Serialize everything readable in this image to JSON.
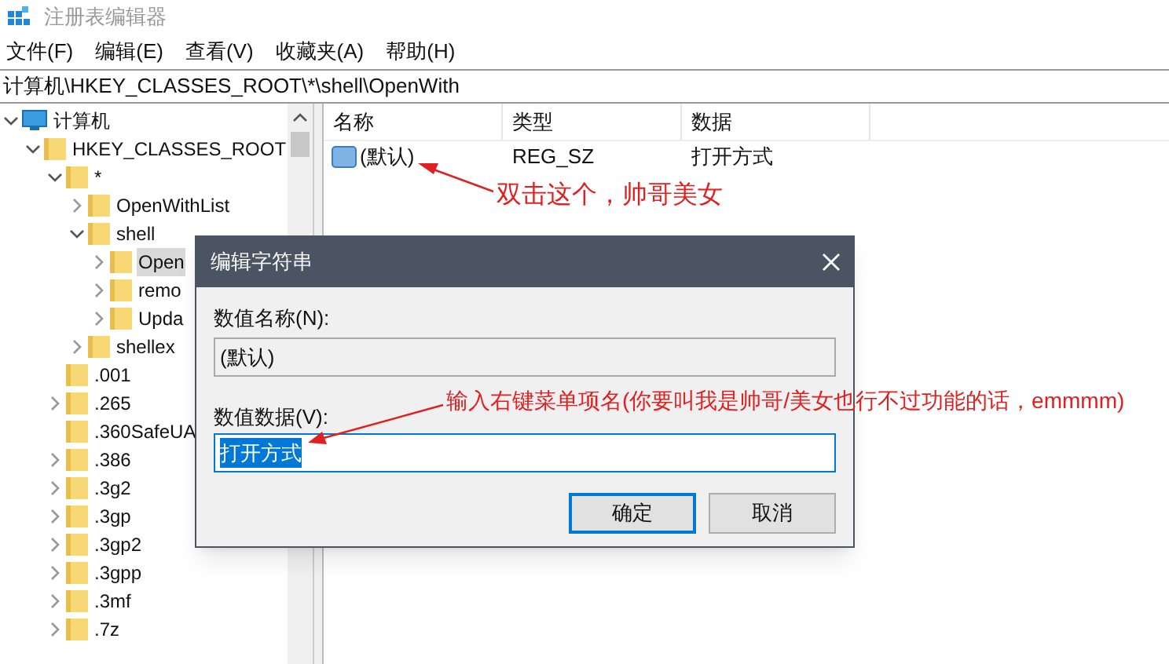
{
  "window": {
    "title": "注册表编辑器"
  },
  "menu": [
    "文件(F)",
    "编辑(E)",
    "查看(V)",
    "收藏夹(A)",
    "帮助(H)"
  ],
  "address": "计算机\\HKEY_CLASSES_ROOT\\*\\shell\\OpenWith",
  "tree": [
    {
      "label": "计算机",
      "kind": "computer",
      "expandable": true,
      "expanded": true,
      "selected": false,
      "children": [
        {
          "label": "HKEY_CLASSES_ROOT",
          "kind": "folder",
          "expandable": true,
          "expanded": true,
          "selected": false,
          "children": [
            {
              "label": "*",
              "kind": "folder",
              "expandable": true,
              "expanded": true,
              "selected": false,
              "children": [
                {
                  "label": "OpenWithList",
                  "kind": "folder",
                  "expandable": true,
                  "expanded": false,
                  "selected": false
                },
                {
                  "label": "shell",
                  "kind": "folder",
                  "expandable": true,
                  "expanded": true,
                  "selected": false,
                  "children": [
                    {
                      "label": "Open",
                      "kind": "folder",
                      "expandable": true,
                      "expanded": false,
                      "selected": true
                    },
                    {
                      "label": "remo",
                      "kind": "folder",
                      "expandable": true,
                      "expanded": false,
                      "selected": false
                    },
                    {
                      "label": "Upda",
                      "kind": "folder",
                      "expandable": true,
                      "expanded": false,
                      "selected": false
                    }
                  ]
                },
                {
                  "label": "shellex",
                  "kind": "folder",
                  "expandable": true,
                  "expanded": false,
                  "selected": false
                }
              ]
            },
            {
              "label": ".001",
              "kind": "folder",
              "expandable": false,
              "selected": false
            },
            {
              "label": ".265",
              "kind": "folder",
              "expandable": true,
              "expanded": false,
              "selected": false
            },
            {
              "label": ".360SafeUA",
              "kind": "folder",
              "expandable": false,
              "selected": false
            },
            {
              "label": ".386",
              "kind": "folder",
              "expandable": true,
              "expanded": false,
              "selected": false
            },
            {
              "label": ".3g2",
              "kind": "folder",
              "expandable": true,
              "expanded": false,
              "selected": false
            },
            {
              "label": ".3gp",
              "kind": "folder",
              "expandable": true,
              "expanded": false,
              "selected": false
            },
            {
              "label": ".3gp2",
              "kind": "folder",
              "expandable": true,
              "expanded": false,
              "selected": false
            },
            {
              "label": ".3gpp",
              "kind": "folder",
              "expandable": true,
              "expanded": false,
              "selected": false
            },
            {
              "label": ".3mf",
              "kind": "folder",
              "expandable": true,
              "expanded": false,
              "selected": false
            },
            {
              "label": ".7z",
              "kind": "folder",
              "expandable": true,
              "expanded": false,
              "selected": false
            }
          ]
        }
      ]
    }
  ],
  "values": {
    "columns": [
      "名称",
      "类型",
      "数据"
    ],
    "rows": [
      {
        "name": "(默认)",
        "type": "REG_SZ",
        "data": "打开方式"
      }
    ]
  },
  "dialog": {
    "title": "编辑字符串",
    "name_label": "数值名称(N):",
    "name_value": "(默认)",
    "data_label": "数值数据(V):",
    "data_value": "打开方式",
    "data_selected": true,
    "buttons": [
      {
        "label": "确定",
        "default": true
      },
      {
        "label": "取消",
        "default": false
      }
    ]
  },
  "annotations": [
    {
      "text": "双击这个，帅哥美女"
    },
    {
      "text": "输入右键菜单项名(你要叫我是帅哥/美女也行不过功能的话，emmmm)"
    }
  ]
}
